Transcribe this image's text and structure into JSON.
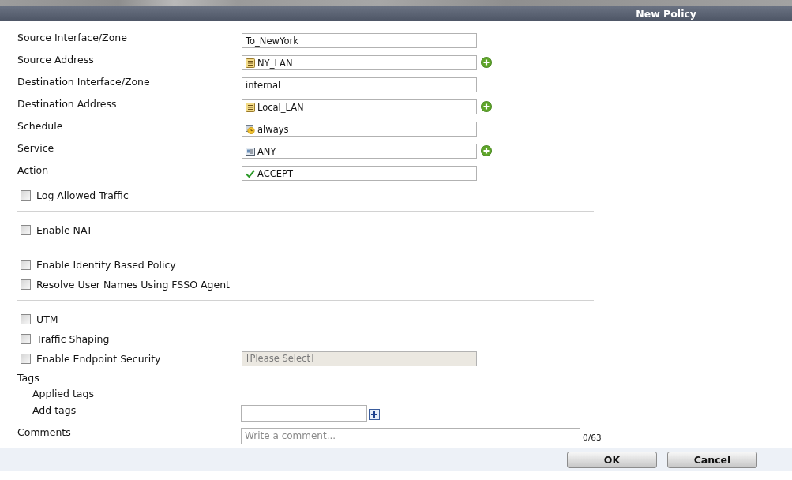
{
  "header": {
    "title": "New Policy"
  },
  "fields": [
    {
      "label": "Source Interface/Zone",
      "kind": "text",
      "value": "To_NewYork",
      "add_button": false
    },
    {
      "label": "Source Address",
      "kind": "address",
      "value": "NY_LAN",
      "add_button": true
    },
    {
      "label": "Destination Interface/Zone",
      "kind": "text",
      "value": "internal",
      "add_button": false
    },
    {
      "label": "Destination Address",
      "kind": "address",
      "value": "Local_LAN",
      "add_button": true
    },
    {
      "label": "Schedule",
      "kind": "schedule",
      "value": "always",
      "add_button": false
    },
    {
      "label": "Service",
      "kind": "service",
      "value": "ANY",
      "add_button": true
    },
    {
      "label": "Action",
      "kind": "action",
      "value": "ACCEPT",
      "add_button": false
    }
  ],
  "option_groups": [
    {
      "items": [
        {
          "label": "Log Allowed Traffic",
          "checked": false
        }
      ]
    },
    {
      "items": [
        {
          "label": "Enable NAT",
          "checked": false
        }
      ]
    },
    {
      "items": [
        {
          "label": "Enable Identity Based Policy",
          "checked": false
        },
        {
          "label": "Resolve User Names Using FSSO Agent",
          "checked": false
        }
      ]
    },
    {
      "items": [
        {
          "label": "UTM",
          "checked": false
        },
        {
          "label": "Traffic Shaping",
          "checked": false
        },
        {
          "label": "Enable Endpoint Security",
          "checked": false,
          "select": {
            "placeholder": "[Please Select]",
            "disabled": true
          }
        }
      ]
    }
  ],
  "tags": {
    "label": "Tags",
    "applied_label": "Applied tags",
    "add_label": "Add tags"
  },
  "comments": {
    "label": "Comments",
    "placeholder": "Write a comment...",
    "counter": "0/63"
  },
  "buttons": [
    {
      "label": "OK"
    },
    {
      "label": "Cancel"
    }
  ]
}
